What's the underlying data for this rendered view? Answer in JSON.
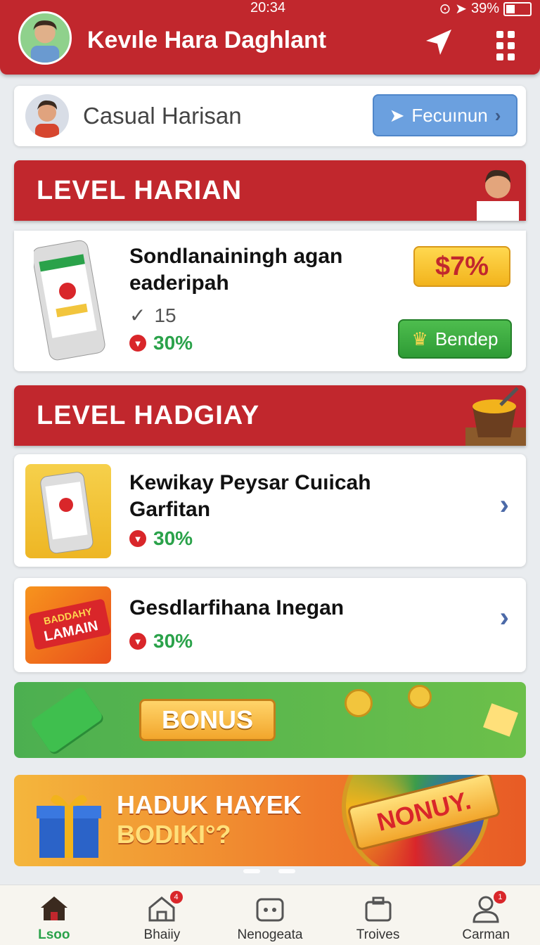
{
  "status_bar": {
    "time": "20:34",
    "battery": "39%",
    "battery_level": 0.39
  },
  "header": {
    "title": "Kevıle Hara Daghlant"
  },
  "profile": {
    "name": "Casual Harisan",
    "button_label": "Fecuınun"
  },
  "sections": [
    {
      "title": "LEVEL HARIAN"
    },
    {
      "title": "LEVEL HADGIAY"
    }
  ],
  "daily_card": {
    "title_line1": "Sondlanainingh agan",
    "title_line2": "eaderipah",
    "count": "15",
    "percent": "30%",
    "badge": "$7%",
    "button_label": "Bendep"
  },
  "items": [
    {
      "title_line1": "Kewikay Peysar Cuıicah",
      "title_line2": "Garfitan",
      "percent": "30%"
    },
    {
      "title_line1": "Gesdlarfihana Inegan",
      "title_line2": "",
      "percent": "30%",
      "thumb_text_top": "BADDAHY",
      "thumb_text_bottom": "LAMAIN"
    }
  ],
  "bonus": {
    "label": "BONUS"
  },
  "promo": {
    "line1": "HADUK HAYEK",
    "line2": "BODIKI°?",
    "badge": "NONUY."
  },
  "nav": [
    {
      "label": "Lsoo",
      "icon": "home-icon",
      "active": true
    },
    {
      "label": "Bhaiiy",
      "icon": "house-badge-icon",
      "badge": "4"
    },
    {
      "label": "Nenogeata",
      "icon": "controller-icon"
    },
    {
      "label": "Troives",
      "icon": "briefcase-icon"
    },
    {
      "label": "Carman",
      "icon": "user-icon",
      "badge": "1"
    }
  ],
  "colors": {
    "brand_red": "#c1272d",
    "accent_green": "#2aa24a",
    "link_blue": "#6ba0df"
  }
}
